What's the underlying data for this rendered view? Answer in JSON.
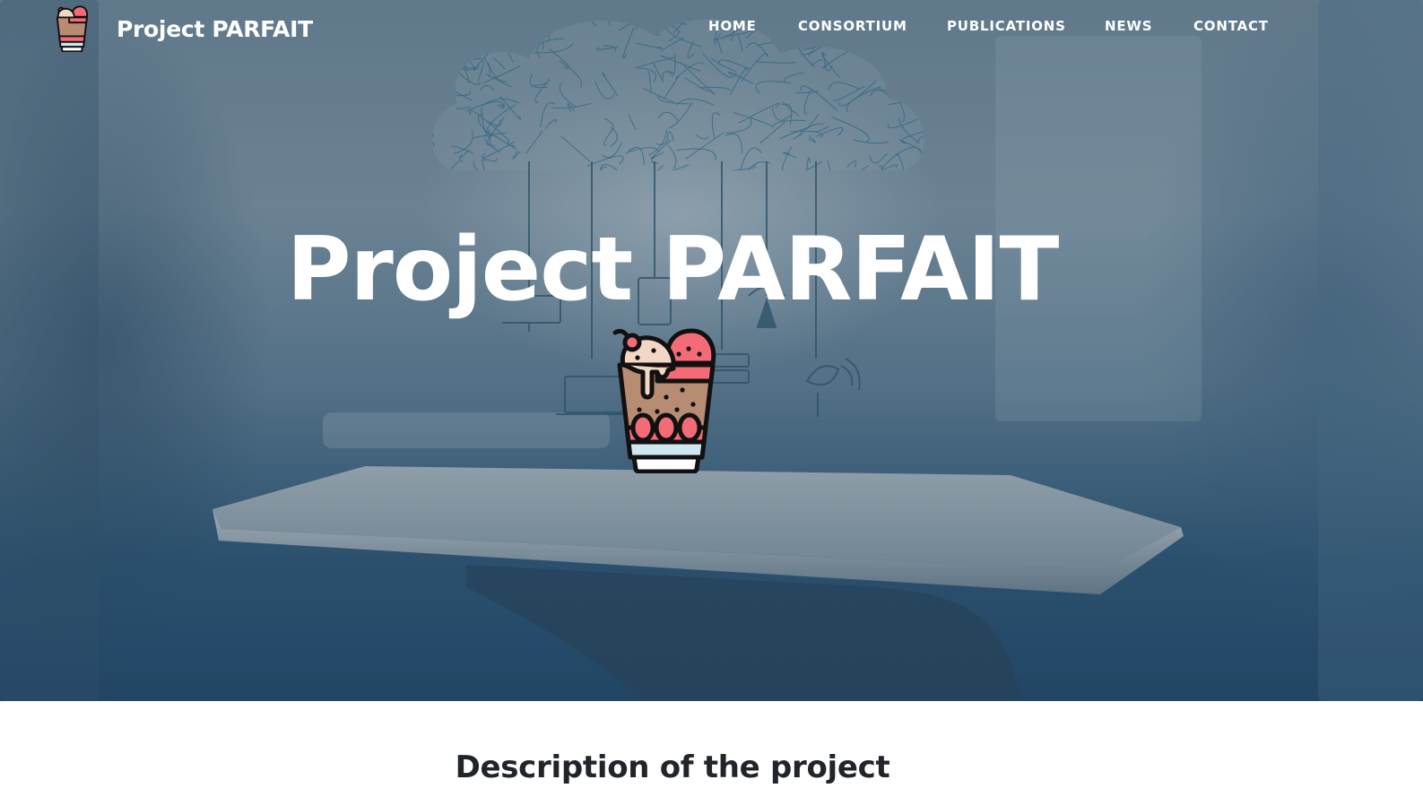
{
  "navbar": {
    "brand_text": "Project PARFAIT",
    "brand_icon": "parfait-icon",
    "links": [
      {
        "label": "HOME"
      },
      {
        "label": "CONSORTIUM"
      },
      {
        "label": "PUBLICATIONS"
      },
      {
        "label": "NEWS"
      },
      {
        "label": "CONTACT"
      }
    ]
  },
  "hero": {
    "title": "Project PARFAIT",
    "logo_icon": "parfait-icon",
    "background": "hand-holding-tablet-cloud-network-photo"
  },
  "content": {
    "section_title": "Description of the project"
  },
  "colors": {
    "nav_text": "#ffffff",
    "hero_text": "#ffffff",
    "heading_text": "#212529",
    "parfait_pink": "#f26b77",
    "parfait_cream": "#f1d7c4",
    "parfait_brown": "#b88b73",
    "parfait_blue": "#cfe7ef"
  }
}
